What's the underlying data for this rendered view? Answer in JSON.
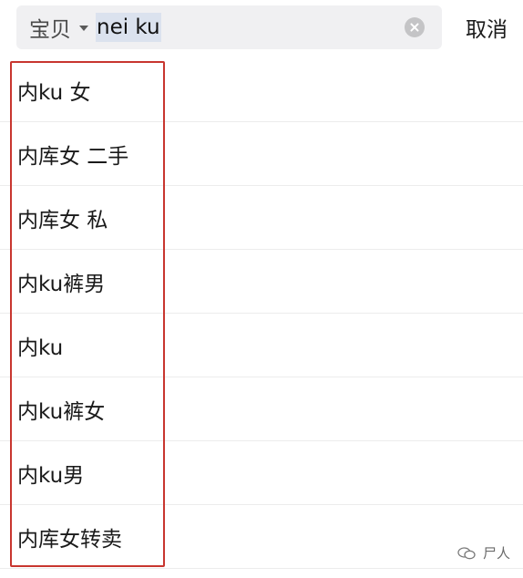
{
  "search": {
    "scope_label": "宝贝",
    "query": "nei ku",
    "cancel_label": "取消"
  },
  "suggestions": [
    "内ku 女",
    "内库女 二手",
    "内库女 私",
    "内ku裤男",
    "内ku",
    "内ku裤女",
    "内ku男",
    "内库女转卖"
  ],
  "watermark": {
    "text": "尸人",
    "icon": "wechat-icon"
  },
  "colors": {
    "highlight": "#c8362f",
    "search_bg": "#f0f0f2",
    "selection": "#dbe2ee"
  }
}
